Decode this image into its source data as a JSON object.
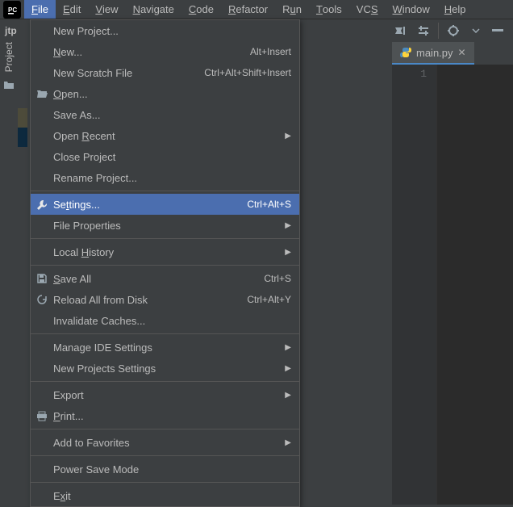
{
  "menubar": {
    "items": [
      {
        "label": "File",
        "u": "F",
        "open": true
      },
      {
        "label": "Edit",
        "u": "E"
      },
      {
        "label": "View",
        "u": "V"
      },
      {
        "label": "Navigate",
        "u": "N"
      },
      {
        "label": "Code",
        "u": "C"
      },
      {
        "label": "Refactor",
        "u": "R"
      },
      {
        "label": "Run",
        "u": "u"
      },
      {
        "label": "Tools",
        "u": "T"
      },
      {
        "label": "VCS",
        "u": "S"
      },
      {
        "label": "Window",
        "u": "W"
      },
      {
        "label": "Help",
        "u": "H"
      }
    ]
  },
  "breadcrumb": "jtp",
  "file_menu": [
    {
      "label": "New Project...",
      "type": "item"
    },
    {
      "label": "New...",
      "u": "N",
      "shortcut": "Alt+Insert",
      "type": "item"
    },
    {
      "label": "New Scratch File",
      "shortcut": "Ctrl+Alt+Shift+Insert",
      "type": "item"
    },
    {
      "label": "Open...",
      "u": "O",
      "icon": "folder-open",
      "type": "item"
    },
    {
      "label": "Save As...",
      "type": "item"
    },
    {
      "label": "Open Recent",
      "u": "R",
      "submenu": true,
      "type": "item"
    },
    {
      "label": "Close Project",
      "type": "item"
    },
    {
      "label": "Rename Project...",
      "type": "item"
    },
    {
      "type": "sep"
    },
    {
      "label": "Settings...",
      "u": "t",
      "shortcut": "Ctrl+Alt+S",
      "icon": "wrench",
      "hover": true,
      "type": "item"
    },
    {
      "label": "File Properties",
      "submenu": true,
      "type": "item"
    },
    {
      "type": "sep"
    },
    {
      "label": "Local History",
      "u": "H",
      "submenu": true,
      "type": "item"
    },
    {
      "type": "sep"
    },
    {
      "label": "Save All",
      "u": "S",
      "shortcut": "Ctrl+S",
      "icon": "save",
      "type": "item"
    },
    {
      "label": "Reload All from Disk",
      "shortcut": "Ctrl+Alt+Y",
      "icon": "reload",
      "type": "item"
    },
    {
      "label": "Invalidate Caches...",
      "type": "item"
    },
    {
      "type": "sep"
    },
    {
      "label": "Manage IDE Settings",
      "submenu": true,
      "type": "item"
    },
    {
      "label": "New Projects Settings",
      "submenu": true,
      "type": "item"
    },
    {
      "type": "sep"
    },
    {
      "label": "Export",
      "submenu": true,
      "type": "item"
    },
    {
      "label": "Print...",
      "u": "P",
      "icon": "print",
      "type": "item"
    },
    {
      "type": "sep"
    },
    {
      "label": "Add to Favorites",
      "submenu": true,
      "type": "item"
    },
    {
      "type": "sep"
    },
    {
      "label": "Power Save Mode",
      "type": "item"
    },
    {
      "type": "sep"
    },
    {
      "label": "Exit",
      "u": "x",
      "type": "item"
    }
  ],
  "left_rail_label": "Project",
  "editor": {
    "tab_filename": "main.py",
    "line_numbers": [
      "1"
    ]
  }
}
